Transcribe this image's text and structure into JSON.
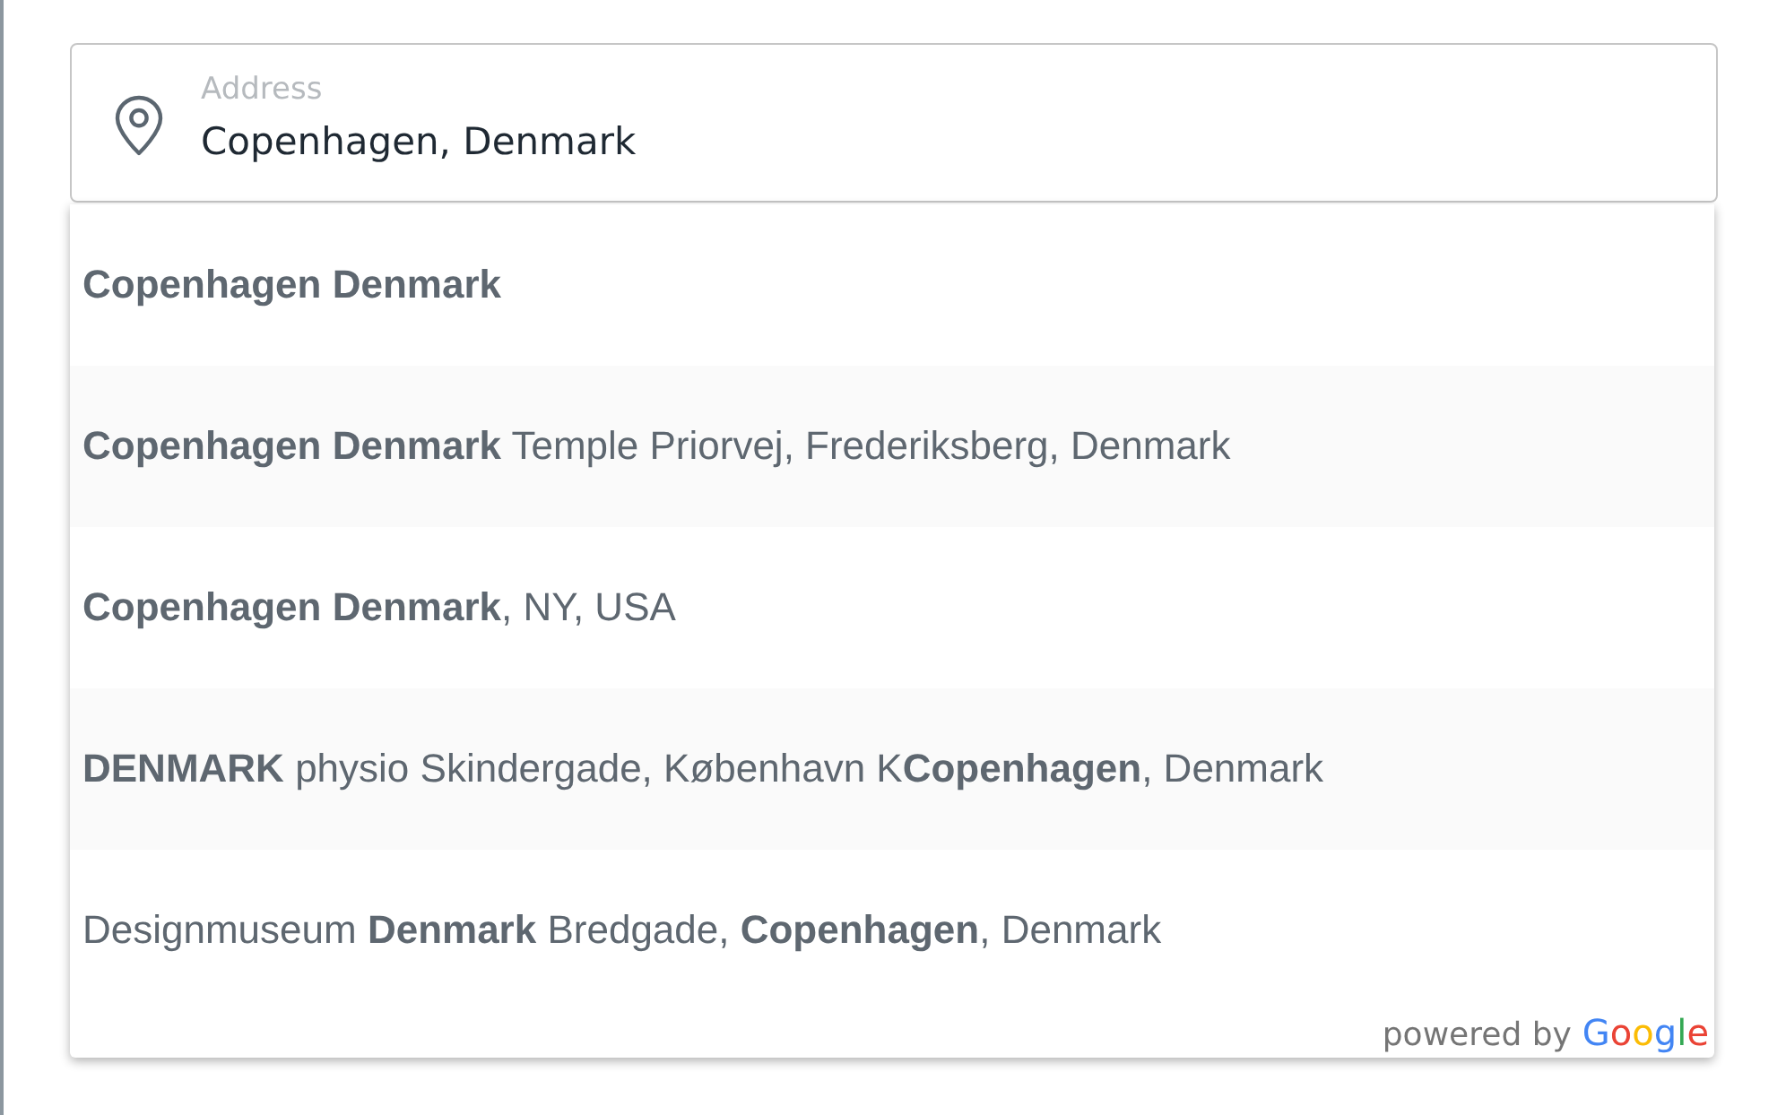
{
  "address_field": {
    "label": "Address",
    "value": "Copenhagen, Denmark"
  },
  "suggestions": [
    {
      "text": "Copenhagen Denmark",
      "bold": true
    },
    {
      "text": "**Copenhagen Denmark** Temple Priorvej, Frederiksberg, Denmark",
      "bold": false
    },
    {
      "text": "**Copenhagen Denmark**, NY, USA",
      "bold": false
    },
    {
      "text": "**DENMARK** physio Skindergade, København K**Copenhagen**, Denmark",
      "bold": false
    },
    {
      "text": "Designmuseum **Denmark** Bredgade, **Copenhagen**, Denmark",
      "bold": false
    }
  ],
  "attribution": {
    "prefix": "powered by",
    "logo": "Google"
  }
}
